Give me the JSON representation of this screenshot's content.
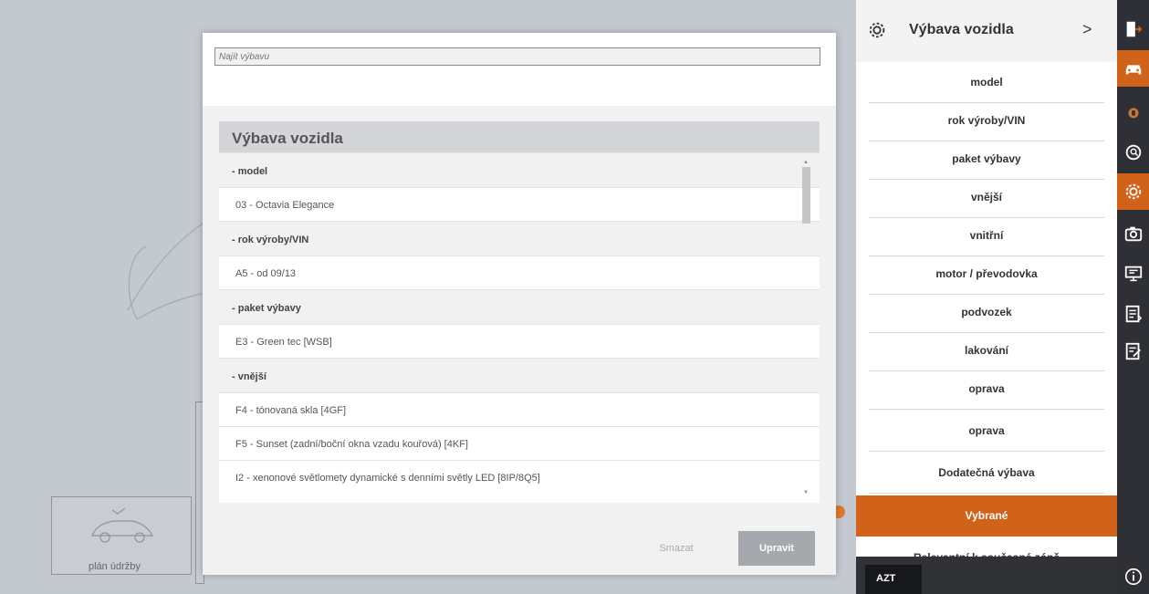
{
  "background": {
    "tile_label": "plán údržby"
  },
  "modal": {
    "search_placeholder": "Najít výbavu",
    "panel_title": "Výbava vozidla",
    "rows": [
      {
        "kind": "group",
        "text": "- model"
      },
      {
        "kind": "item",
        "text": "03 - Octavia Elegance"
      },
      {
        "kind": "group",
        "text": "- rok výroby/VIN"
      },
      {
        "kind": "item",
        "text": "A5 - od 09/13"
      },
      {
        "kind": "group",
        "text": "- paket výbavy"
      },
      {
        "kind": "item",
        "text": "E3 - Green tec  [WSB]"
      },
      {
        "kind": "group",
        "text": "- vnější"
      },
      {
        "kind": "item",
        "text": "F4 - tónovaná skla  [4GF]"
      },
      {
        "kind": "item",
        "text": "F5 - Sunset (zadní/boční okna vzadu kouřová)  [4KF]"
      },
      {
        "kind": "item",
        "text": "I2 - xenonové světlomety dynamické s denními světly LED  [8IP/8Q5]"
      }
    ],
    "clear_label": "Smazat",
    "edit_label": "Upravit"
  },
  "sidemenu": {
    "title": "Výbava vozidla",
    "items": [
      {
        "label": "model",
        "active": false
      },
      {
        "label": "rok výroby/VIN",
        "active": false
      },
      {
        "label": "paket výbavy",
        "active": false
      },
      {
        "label": "vnější",
        "active": false
      },
      {
        "label": "vnitřní",
        "active": false
      },
      {
        "label": "motor / převodovka",
        "active": false
      },
      {
        "label": "podvozek",
        "active": false
      },
      {
        "label": "lakování",
        "active": false
      },
      {
        "label": "oprava",
        "active": false
      },
      {
        "label": "oprava",
        "active": false
      },
      {
        "label": "Dodatečná výbava",
        "active": false
      },
      {
        "label": "Vybrané",
        "active": true
      },
      {
        "label": "Relevantní k současné zóně",
        "active": false
      }
    ],
    "azt_label": "AZT"
  },
  "rail": {
    "icons": [
      {
        "name": "exit-icon",
        "active": false
      },
      {
        "name": "car-icon",
        "active": true
      },
      {
        "name": "lock-icon",
        "active": false
      },
      {
        "name": "search-icon",
        "active": false
      },
      {
        "name": "gear-icon",
        "active": true
      },
      {
        "name": "camera-icon",
        "active": false
      },
      {
        "name": "monitor-icon",
        "active": false
      },
      {
        "name": "document-list-icon",
        "active": false
      },
      {
        "name": "document-edit-icon",
        "active": false
      },
      {
        "name": "info-icon",
        "active": false
      }
    ],
    "accent": "#d1621a"
  }
}
